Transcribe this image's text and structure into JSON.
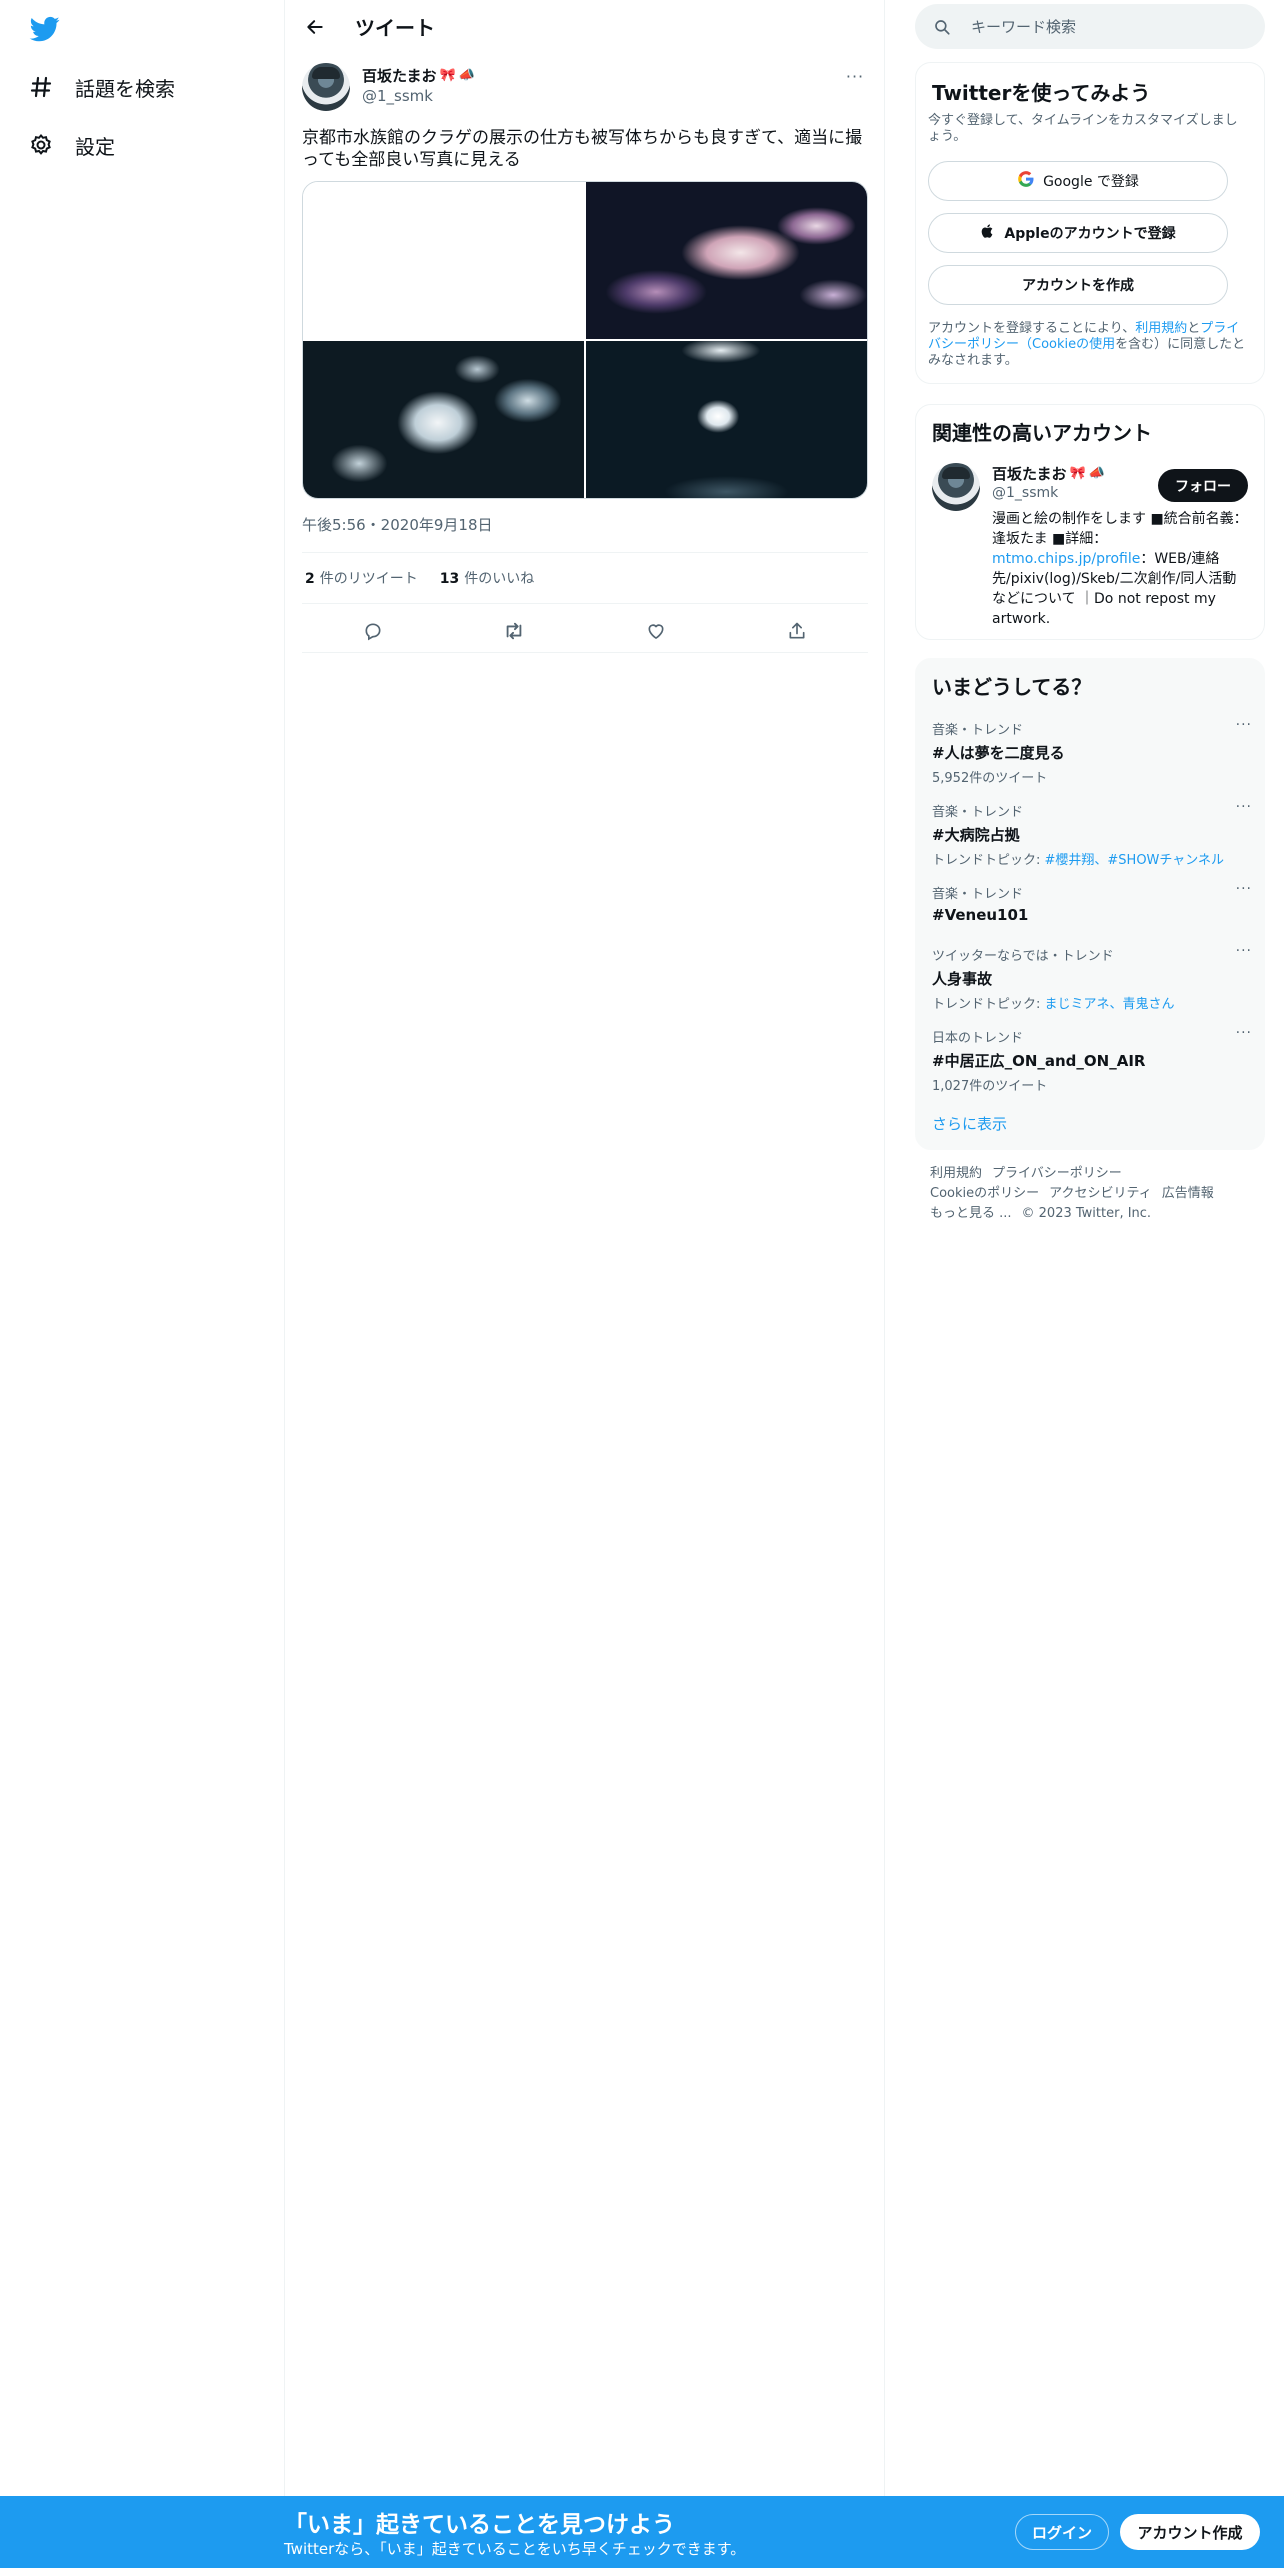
{
  "nav": {
    "explore_label": "話題を検索",
    "settings_label": "設定"
  },
  "header": {
    "title": "ツイート"
  },
  "tweet": {
    "author_name": "百坂たまお",
    "author_emoji": [
      "🎀",
      "📣"
    ],
    "author_handle": "@1_ssmk",
    "text": "京都市水族館のクラゲの展示の仕方も被写体ちからも良すぎて、適当に撮っても全部良い写真に見える",
    "timestamp": "午後5:56・2020年9月18日",
    "retweet_count": "2",
    "retweet_label": "件のリツイート",
    "like_count": "13",
    "like_label": "件のいいね",
    "more_glyph": "···"
  },
  "search": {
    "placeholder": "キーワード検索"
  },
  "signup_card": {
    "title": "Twitterを使ってみよう",
    "subtitle": "今すぐ登録して、タイムラインをカスタマイズしましょう。",
    "google_label": "Google で登録",
    "apple_label": "Appleのアカウントで登録",
    "create_label": "アカウントを作成",
    "legal_prefix": "アカウントを登録することにより、",
    "legal_terms": "利用規約",
    "legal_and": "と",
    "legal_privacy": "プライバシーポリシー",
    "legal_paren_open": "（",
    "legal_cookie": "Cookieの使用",
    "legal_suffix": "を含む）に同意したとみなされます。"
  },
  "relevant": {
    "title": "関連性の高いアカウント",
    "name": "百坂たまお",
    "handle": "@1_ssmk",
    "follow_label": "フォロー",
    "bio_before": "漫画と絵の制作をします ■統合前名義：逢坂たま ■詳細：",
    "bio_link": "mtmo.chips.jp/profile",
    "bio_after": "：WEB/連絡先/pixiv(log)/Skeb/二次創作/同人活動などについて ｜Do not repost my artwork."
  },
  "trends": {
    "title": "いまどうしてる？",
    "show_more": "さらに表示",
    "items": [
      {
        "category": "音楽・トレンド",
        "name": "#人は夢を二度見る",
        "count": "5,952件のツイート"
      },
      {
        "category": "音楽・トレンド",
        "name": "#大病院占拠",
        "topic_label": "トレンドトピック: ",
        "topics": "#櫻井翔、#SHOWチャンネル"
      },
      {
        "category": "音楽・トレンド",
        "name": "#Veneu101"
      },
      {
        "category": "ツイッターならでは・トレンド",
        "name": "人身事故",
        "topic_label": "トレンドトピック: ",
        "topics": "まじミアネ、青鬼さん"
      },
      {
        "category": "日本のトレンド",
        "name": "#中居正広_ON_and_ON_AIR",
        "count": "1,027件のツイート"
      }
    ]
  },
  "footer": {
    "terms": "利用規約",
    "privacy": "プライバシーポリシー",
    "cookie": "Cookieのポリシー",
    "accessibility": "アクセシビリティ",
    "ads": "広告情報",
    "more": "もっと見る ...",
    "copyright": "© 2023 Twitter, Inc."
  },
  "bottom_bar": {
    "title": "「いま」起きていることを見つけよう",
    "subtitle": "Twitterなら、「いま」起きていることをいち早くチェックできます。",
    "login_label": "ログイン",
    "signup_label": "アカウント作成"
  },
  "colors": {
    "accent": "#1d9bf0",
    "text": "#0f1419",
    "secondary": "#536471"
  }
}
